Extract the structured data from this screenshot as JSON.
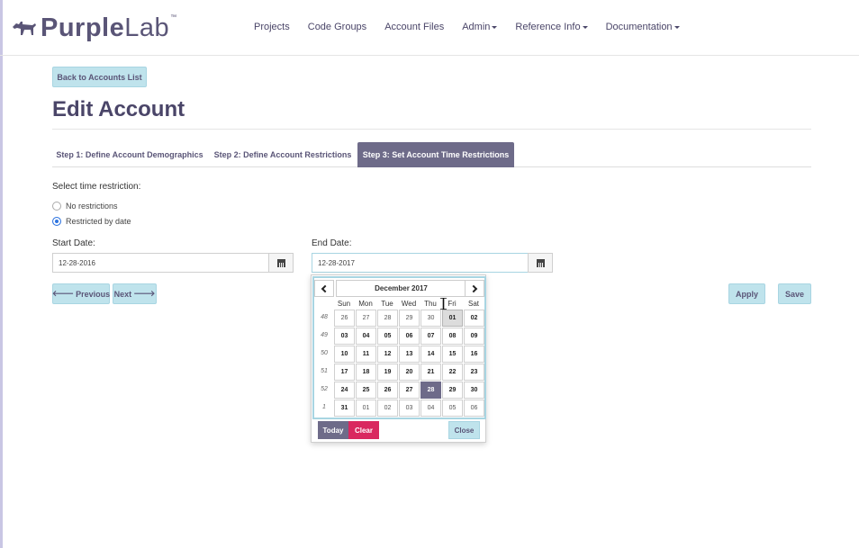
{
  "brand": {
    "name_bold": "Purple",
    "name_light": "Lab",
    "tm": "™"
  },
  "nav": [
    {
      "label": "Projects",
      "dropdown": false
    },
    {
      "label": "Code Groups",
      "dropdown": false
    },
    {
      "label": "Account Files",
      "dropdown": false
    },
    {
      "label": "Admin",
      "dropdown": true
    },
    {
      "label": "Reference Info",
      "dropdown": true
    },
    {
      "label": "Documentation",
      "dropdown": true
    }
  ],
  "back_button": "Back to Accounts List",
  "page_title": "Edit Account",
  "tabs": [
    "Step 1: Define Account Demographics",
    "Step 2: Define Account Restrictions",
    "Step 3: Set Account Time Restrictions"
  ],
  "time_restriction": {
    "label": "Select time restriction:",
    "options": [
      "No restrictions",
      "Restricted by date"
    ],
    "selected": "Restricted by date"
  },
  "start_date": {
    "label": "Start Date:",
    "value": "12-28-2016"
  },
  "end_date": {
    "label": "End Date:",
    "value": "12-28-2017"
  },
  "buttons": {
    "previous": "Previous",
    "next": "Next",
    "apply": "Apply",
    "save": "Save"
  },
  "datepicker": {
    "title": "December 2017",
    "dow": [
      "Sun",
      "Mon",
      "Tue",
      "Wed",
      "Thu",
      "Fri",
      "Sat"
    ],
    "weeks": [
      "48",
      "49",
      "50",
      "51",
      "52",
      "1"
    ],
    "rows": [
      [
        "26",
        "27",
        "28",
        "29",
        "30",
        "01",
        "02"
      ],
      [
        "03",
        "04",
        "05",
        "06",
        "07",
        "08",
        "09"
      ],
      [
        "10",
        "11",
        "12",
        "13",
        "14",
        "15",
        "16"
      ],
      [
        "17",
        "18",
        "19",
        "20",
        "21",
        "22",
        "23"
      ],
      [
        "24",
        "25",
        "26",
        "27",
        "28",
        "29",
        "30"
      ],
      [
        "31",
        "01",
        "02",
        "03",
        "04",
        "05",
        "06"
      ]
    ],
    "today_button": "Today",
    "clear_button": "Clear",
    "close_button": "Close"
  },
  "colors": {
    "brand_purple": "#6e6b89",
    "light_button": "#bfe3ec",
    "clear_pink": "#d9285f",
    "radio_blue": "#2e74e0"
  }
}
